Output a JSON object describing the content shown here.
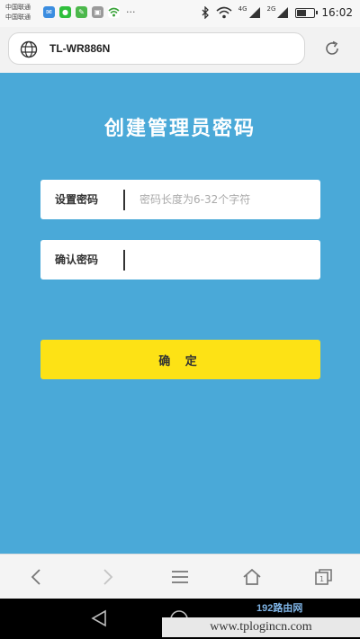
{
  "status_bar": {
    "carrier_lines": [
      "中国联通",
      "中国联通"
    ],
    "signal_labels": [
      "4G",
      "2G"
    ],
    "battery_level": 0.6,
    "time": "16:02"
  },
  "address_bar": {
    "url": "TL-WR886N"
  },
  "page": {
    "title": "创建管理员密码",
    "set_password": {
      "label": "设置密码",
      "placeholder": "密码长度为6-32个字符"
    },
    "confirm_password": {
      "label": "确认密码",
      "placeholder": ""
    },
    "confirm_button": "确 定"
  },
  "watermark": {
    "logo": "192路由网",
    "site": "www.tplogincn.com"
  },
  "colors": {
    "page_background": "#4aa9d8",
    "button_background": "#fde215"
  }
}
